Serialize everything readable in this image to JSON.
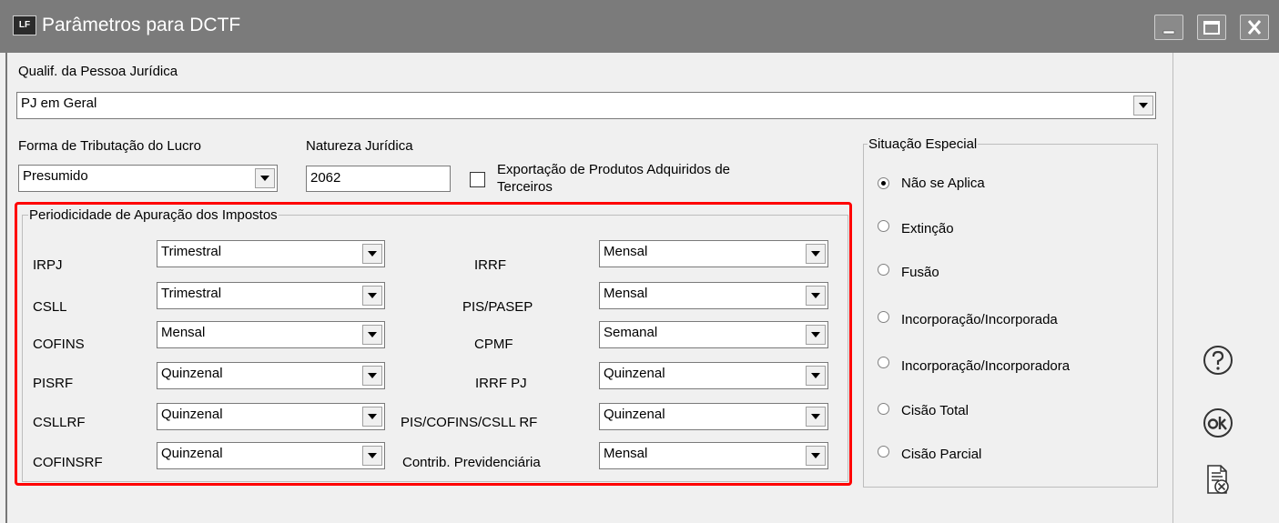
{
  "window": {
    "title": "Parâmetros para DCTF",
    "icon_text": "LF",
    "controls": [
      "minimize-icon",
      "maximize-icon",
      "close-icon"
    ]
  },
  "qualif": {
    "label": "Qualif. da Pessoa Jurídica",
    "value": "PJ em Geral"
  },
  "forma": {
    "label": "Forma de Tributação do Lucro",
    "value": "Presumido"
  },
  "natureza": {
    "label": "Natureza Jurídica",
    "value": "2062"
  },
  "exportacao": {
    "line1": "Exportação de Produtos Adquiridos de",
    "line2": "Terceiros",
    "checked": false
  },
  "periodicidade": {
    "legend": "Periodicidade de Apuração dos Impostos",
    "left": [
      {
        "label": "IRPJ",
        "value": "Trimestral"
      },
      {
        "label": "CSLL",
        "value": "Trimestral"
      },
      {
        "label": "COFINS",
        "value": "Mensal"
      },
      {
        "label": "PISRF",
        "value": "Quinzenal"
      },
      {
        "label": "CSLLRF",
        "value": "Quinzenal"
      },
      {
        "label": "COFINSRF",
        "value": "Quinzenal"
      }
    ],
    "right": [
      {
        "label": "IRRF",
        "value": "Mensal"
      },
      {
        "label": "PIS/PASEP",
        "value": "Mensal"
      },
      {
        "label": "CPMF",
        "value": "Semanal"
      },
      {
        "label": "IRRF PJ",
        "value": "Quinzenal"
      },
      {
        "label": "PIS/COFINS/CSLL RF",
        "value": "Quinzenal"
      },
      {
        "label": "Contrib. Previdenciária",
        "value": "Mensal"
      }
    ]
  },
  "situacao": {
    "legend": "Situação Especial",
    "options": [
      "Não se Aplica",
      "Extinção",
      "Fusão",
      "Incorporação/Incorporada",
      "Incorporação/Incorporadora",
      "Cisão Total",
      "Cisão Parcial"
    ],
    "selected_index": 0
  },
  "side_buttons": [
    "help-icon",
    "ok-icon",
    "cancel-document-icon"
  ],
  "colors": {
    "titlebar": "#7b7b7b",
    "highlight": "#ff0000"
  }
}
